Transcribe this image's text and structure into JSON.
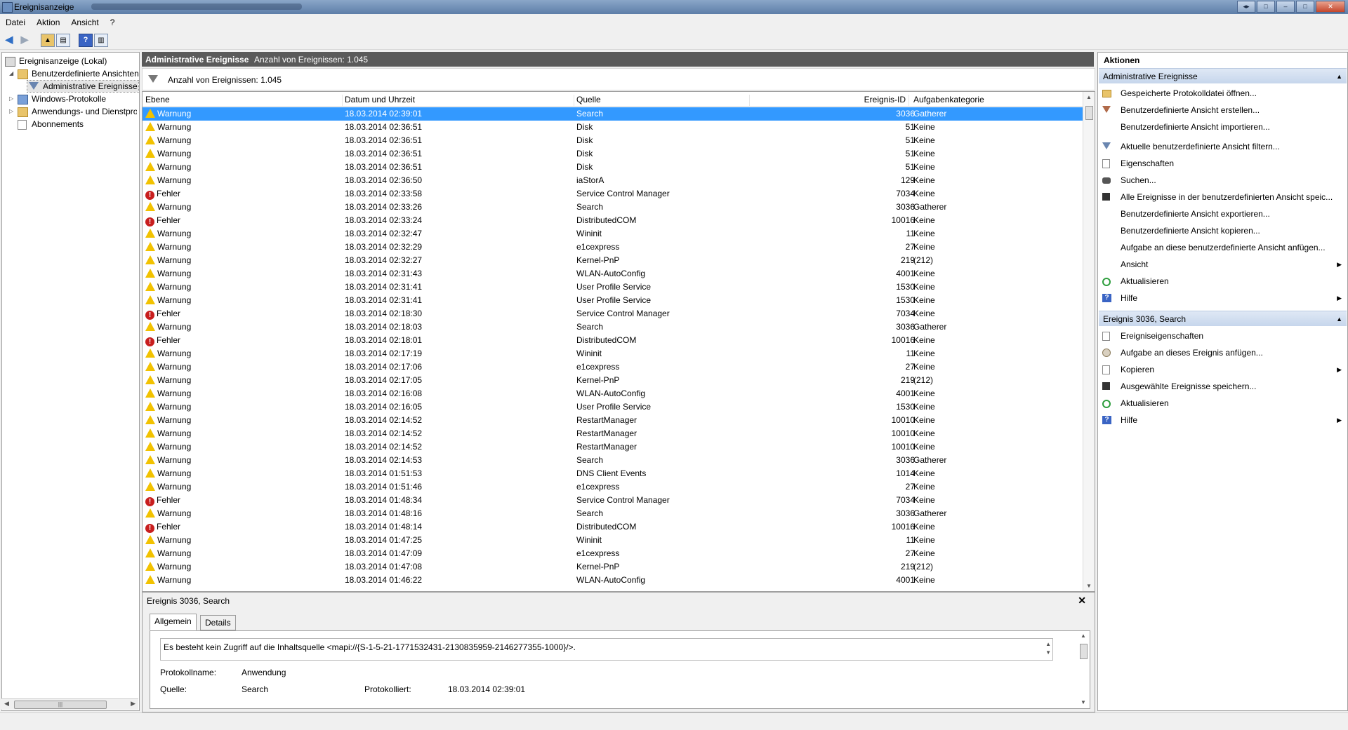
{
  "window": {
    "title": "Ereignisanzeige"
  },
  "menu": [
    "Datei",
    "Aktion",
    "Ansicht",
    "?"
  ],
  "tree": {
    "root": "Ereignisanzeige (Lokal)",
    "custom_views": "Benutzerdefinierte Ansichten",
    "admin_events": "Administrative Ereignisse",
    "windows_logs": "Windows-Protokolle",
    "app_logs": "Anwendungs- und Dienstprotokolle",
    "subscriptions": "Abonnements"
  },
  "center": {
    "title": "Administrative Ereignisse",
    "count": "Anzahl von Ereignissen: 1.045",
    "filter_text": "Anzahl von Ereignissen: 1.045",
    "columns": [
      "Ebene",
      "Datum und Uhrzeit",
      "Quelle",
      "Ereignis-ID",
      "Aufgabenkategorie"
    ],
    "rows": [
      {
        "level": "Warnung",
        "type": "warn",
        "dt": "18.03.2014 02:39:01",
        "src": "Search",
        "id": "3036",
        "cat": "Gatherer"
      },
      {
        "level": "Warnung",
        "type": "warn",
        "dt": "18.03.2014 02:36:51",
        "src": "Disk",
        "id": "51",
        "cat": "Keine"
      },
      {
        "level": "Warnung",
        "type": "warn",
        "dt": "18.03.2014 02:36:51",
        "src": "Disk",
        "id": "51",
        "cat": "Keine"
      },
      {
        "level": "Warnung",
        "type": "warn",
        "dt": "18.03.2014 02:36:51",
        "src": "Disk",
        "id": "51",
        "cat": "Keine"
      },
      {
        "level": "Warnung",
        "type": "warn",
        "dt": "18.03.2014 02:36:51",
        "src": "Disk",
        "id": "51",
        "cat": "Keine"
      },
      {
        "level": "Warnung",
        "type": "warn",
        "dt": "18.03.2014 02:36:50",
        "src": "iaStorA",
        "id": "129",
        "cat": "Keine"
      },
      {
        "level": "Fehler",
        "type": "err",
        "dt": "18.03.2014 02:33:58",
        "src": "Service Control Manager",
        "id": "7034",
        "cat": "Keine"
      },
      {
        "level": "Warnung",
        "type": "warn",
        "dt": "18.03.2014 02:33:26",
        "src": "Search",
        "id": "3036",
        "cat": "Gatherer"
      },
      {
        "level": "Fehler",
        "type": "err",
        "dt": "18.03.2014 02:33:24",
        "src": "DistributedCOM",
        "id": "10016",
        "cat": "Keine"
      },
      {
        "level": "Warnung",
        "type": "warn",
        "dt": "18.03.2014 02:32:47",
        "src": "Wininit",
        "id": "11",
        "cat": "Keine"
      },
      {
        "level": "Warnung",
        "type": "warn",
        "dt": "18.03.2014 02:32:29",
        "src": "e1cexpress",
        "id": "27",
        "cat": "Keine"
      },
      {
        "level": "Warnung",
        "type": "warn",
        "dt": "18.03.2014 02:32:27",
        "src": "Kernel-PnP",
        "id": "219",
        "cat": "(212)"
      },
      {
        "level": "Warnung",
        "type": "warn",
        "dt": "18.03.2014 02:31:43",
        "src": "WLAN-AutoConfig",
        "id": "4001",
        "cat": "Keine"
      },
      {
        "level": "Warnung",
        "type": "warn",
        "dt": "18.03.2014 02:31:41",
        "src": "User Profile Service",
        "id": "1530",
        "cat": "Keine"
      },
      {
        "level": "Warnung",
        "type": "warn",
        "dt": "18.03.2014 02:31:41",
        "src": "User Profile Service",
        "id": "1530",
        "cat": "Keine"
      },
      {
        "level": "Fehler",
        "type": "err",
        "dt": "18.03.2014 02:18:30",
        "src": "Service Control Manager",
        "id": "7034",
        "cat": "Keine"
      },
      {
        "level": "Warnung",
        "type": "warn",
        "dt": "18.03.2014 02:18:03",
        "src": "Search",
        "id": "3036",
        "cat": "Gatherer"
      },
      {
        "level": "Fehler",
        "type": "err",
        "dt": "18.03.2014 02:18:01",
        "src": "DistributedCOM",
        "id": "10016",
        "cat": "Keine"
      },
      {
        "level": "Warnung",
        "type": "warn",
        "dt": "18.03.2014 02:17:19",
        "src": "Wininit",
        "id": "11",
        "cat": "Keine"
      },
      {
        "level": "Warnung",
        "type": "warn",
        "dt": "18.03.2014 02:17:06",
        "src": "e1cexpress",
        "id": "27",
        "cat": "Keine"
      },
      {
        "level": "Warnung",
        "type": "warn",
        "dt": "18.03.2014 02:17:05",
        "src": "Kernel-PnP",
        "id": "219",
        "cat": "(212)"
      },
      {
        "level": "Warnung",
        "type": "warn",
        "dt": "18.03.2014 02:16:08",
        "src": "WLAN-AutoConfig",
        "id": "4001",
        "cat": "Keine"
      },
      {
        "level": "Warnung",
        "type": "warn",
        "dt": "18.03.2014 02:16:05",
        "src": "User Profile Service",
        "id": "1530",
        "cat": "Keine"
      },
      {
        "level": "Warnung",
        "type": "warn",
        "dt": "18.03.2014 02:14:52",
        "src": "RestartManager",
        "id": "10010",
        "cat": "Keine"
      },
      {
        "level": "Warnung",
        "type": "warn",
        "dt": "18.03.2014 02:14:52",
        "src": "RestartManager",
        "id": "10010",
        "cat": "Keine"
      },
      {
        "level": "Warnung",
        "type": "warn",
        "dt": "18.03.2014 02:14:52",
        "src": "RestartManager",
        "id": "10010",
        "cat": "Keine"
      },
      {
        "level": "Warnung",
        "type": "warn",
        "dt": "18.03.2014 02:14:53",
        "src": "Search",
        "id": "3036",
        "cat": "Gatherer"
      },
      {
        "level": "Warnung",
        "type": "warn",
        "dt": "18.03.2014 01:51:53",
        "src": "DNS Client Events",
        "id": "1014",
        "cat": "Keine"
      },
      {
        "level": "Warnung",
        "type": "warn",
        "dt": "18.03.2014 01:51:46",
        "src": "e1cexpress",
        "id": "27",
        "cat": "Keine"
      },
      {
        "level": "Fehler",
        "type": "err",
        "dt": "18.03.2014 01:48:34",
        "src": "Service Control Manager",
        "id": "7034",
        "cat": "Keine"
      },
      {
        "level": "Warnung",
        "type": "warn",
        "dt": "18.03.2014 01:48:16",
        "src": "Search",
        "id": "3036",
        "cat": "Gatherer"
      },
      {
        "level": "Fehler",
        "type": "err",
        "dt": "18.03.2014 01:48:14",
        "src": "DistributedCOM",
        "id": "10016",
        "cat": "Keine"
      },
      {
        "level": "Warnung",
        "type": "warn",
        "dt": "18.03.2014 01:47:25",
        "src": "Wininit",
        "id": "11",
        "cat": "Keine"
      },
      {
        "level": "Warnung",
        "type": "warn",
        "dt": "18.03.2014 01:47:09",
        "src": "e1cexpress",
        "id": "27",
        "cat": "Keine"
      },
      {
        "level": "Warnung",
        "type": "warn",
        "dt": "18.03.2014 01:47:08",
        "src": "Kernel-PnP",
        "id": "219",
        "cat": "(212)"
      },
      {
        "level": "Warnung",
        "type": "warn",
        "dt": "18.03.2014 01:46:22",
        "src": "WLAN-AutoConfig",
        "id": "4001",
        "cat": "Keine"
      }
    ]
  },
  "detail": {
    "title": "Ereignis 3036, Search",
    "close": "✕",
    "tabs": [
      "Allgemein",
      "Details"
    ],
    "message": "Es besteht kein Zugriff auf die Inhaltsquelle <mapi://{S-1-5-21-1771532431-2130835959-2146277355-1000}/>.",
    "log_label": "Protokollname:",
    "log_value": "Anwendung",
    "src_label": "Quelle:",
    "src_value": "Search",
    "logged_label": "Protokolliert:",
    "logged_value": "18.03.2014 02:39:01"
  },
  "actions": {
    "title": "Aktionen",
    "section1": "Administrative Ereignisse",
    "items1": [
      {
        "label": "Gespeicherte Protokolldatei öffnen...",
        "icon": "open"
      },
      {
        "label": "Benutzerdefinierte Ansicht erstellen...",
        "icon": "filtr"
      },
      {
        "label": "Benutzerdefinierte Ansicht importieren...",
        "icon": ""
      },
      {
        "label": "Aktuelle benutzerdefinierte Ansicht filtern...",
        "icon": "filt"
      },
      {
        "label": "Eigenschaften",
        "icon": "doc"
      },
      {
        "label": "Suchen...",
        "icon": "bino"
      },
      {
        "label": "Alle Ereignisse in der benutzerdefinierten Ansicht speic...",
        "icon": "save"
      },
      {
        "label": "Benutzerdefinierte Ansicht exportieren...",
        "icon": ""
      },
      {
        "label": "Benutzerdefinierte Ansicht kopieren...",
        "icon": ""
      },
      {
        "label": "Aufgabe an diese benutzerdefinierte Ansicht anfügen...",
        "icon": ""
      },
      {
        "label": "Ansicht",
        "icon": "",
        "sub": true
      },
      {
        "label": "Aktualisieren",
        "icon": "refresh"
      },
      {
        "label": "Hilfe",
        "icon": "help",
        "sub": true
      }
    ],
    "section2": "Ereignis 3036, Search",
    "items2": [
      {
        "label": "Ereigniseigenschaften",
        "icon": "doc"
      },
      {
        "label": "Aufgabe an dieses Ereignis anfügen...",
        "icon": "task"
      },
      {
        "label": "Kopieren",
        "icon": "doc",
        "sub": true
      },
      {
        "label": "Ausgewählte Ereignisse speichern...",
        "icon": "save"
      },
      {
        "label": "Aktualisieren",
        "icon": "refresh"
      },
      {
        "label": "Hilfe",
        "icon": "help",
        "sub": true
      }
    ]
  }
}
